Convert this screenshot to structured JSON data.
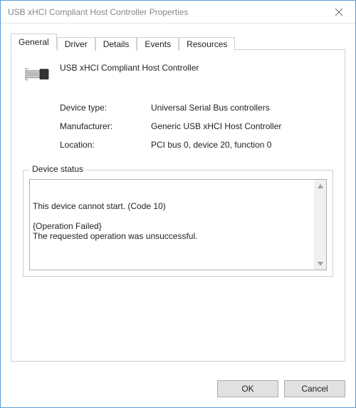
{
  "window": {
    "title": "USB xHCI Compliant Host Controller Properties"
  },
  "tabs": [
    {
      "label": "General"
    },
    {
      "label": "Driver"
    },
    {
      "label": "Details"
    },
    {
      "label": "Events"
    },
    {
      "label": "Resources"
    }
  ],
  "device": {
    "name": "USB xHCI Compliant Host Controller",
    "icon": "usb-connector-icon",
    "type_label": "Device type:",
    "type_value": "Universal Serial Bus controllers",
    "manufacturer_label": "Manufacturer:",
    "manufacturer_value": "Generic USB xHCI Host Controller",
    "location_label": "Location:",
    "location_value": "PCI bus 0, device 20, function 0"
  },
  "status": {
    "legend": "Device status",
    "text": "This device cannot start. (Code 10)\n\n{Operation Failed}\nThe requested operation was unsuccessful."
  },
  "buttons": {
    "ok": "OK",
    "cancel": "Cancel"
  }
}
